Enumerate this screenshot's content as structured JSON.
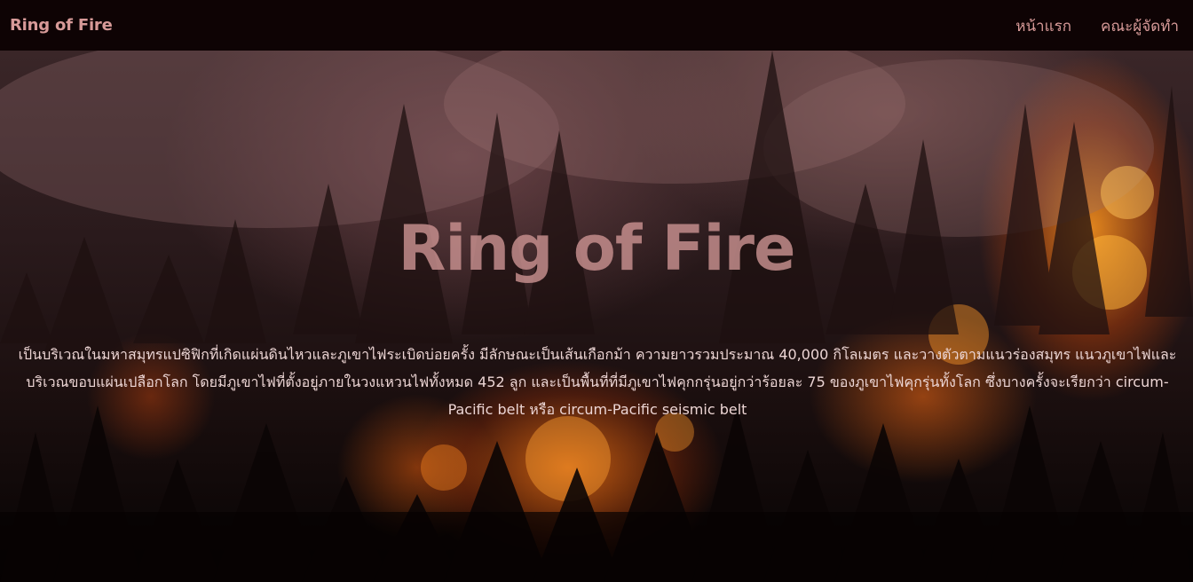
{
  "navbar": {
    "brand": "Ring of Fire",
    "links": [
      {
        "label": "หน้าแรก"
      },
      {
        "label": "คณะผู้จัดทำ"
      }
    ]
  },
  "hero": {
    "title": "Ring of Fire",
    "description": "เป็นบริเวณในมหาสมุทรแปซิฟิกที่เกิดแผ่นดินไหวและภูเขาไฟระเบิดบ่อยครั้ง มีลักษณะเป็นเส้นเกือกม้า ความยาวรวมประมาณ 40,000 กิโลเมตร และวางตัวตามแนวร่องสมุทร แนวภูเขาไฟและบริเวณขอบแผ่นเปลือกโลก โดยมีภูเขาไฟที่ตั้งอยู่ภายในวงแหวนไฟทั้งหมด 452 ลูก และเป็นพื้นที่ที่มีภูเขาไฟคุกกรุ่นอยู่กว่าร้อยละ 75 ของภูเขาไฟคุกรุ่นทั้งโลก ซึ่งบางครั้งจะเรียกว่า circum-Pacific belt หรือ circum-Pacific seismic belt",
    "background_description_hidden": ""
  },
  "colors": {
    "navbar_bg": "#0e0304",
    "brand": "#d79a98",
    "title": "#c99190",
    "text": "#ecd5d4"
  }
}
